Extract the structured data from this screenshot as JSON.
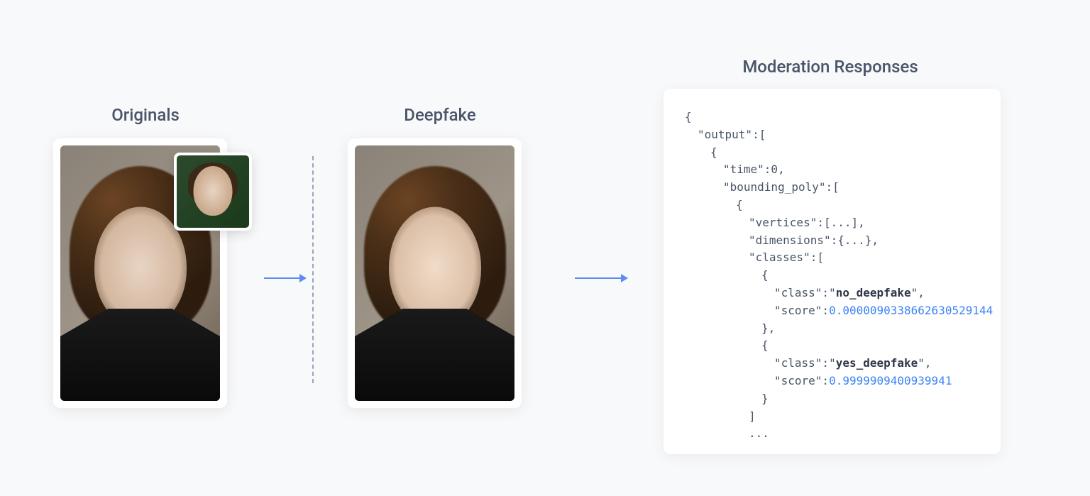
{
  "titles": {
    "originals": "Originals",
    "deepfake": "Deepfake",
    "moderation": "Moderation Responses"
  },
  "json_response": {
    "l1": "{",
    "l2": "\"output\":[",
    "l3": "{",
    "l4": "\"time\":0,",
    "l5": "\"bounding_poly\":[",
    "l6": "{",
    "l7": "\"vertices\":[...],",
    "l8": "\"dimensions\":{...},",
    "l9": "\"classes\":[",
    "l10": "{",
    "l11_pre": "\"class\":\"",
    "l11_bold": "no_deepfake",
    "l11_post": "\",",
    "l12_pre": "\"score\":",
    "l12_val": "0.0000090338662630529144",
    "l13": "},",
    "l14": "{",
    "l15_pre": "\"class\":\"",
    "l15_bold": "yes_deepfake",
    "l15_post": "\",",
    "l16_pre": "\"score\":",
    "l16_val": "0.9999909400939941",
    "l17": "}",
    "l18": "]",
    "l19": "..."
  }
}
